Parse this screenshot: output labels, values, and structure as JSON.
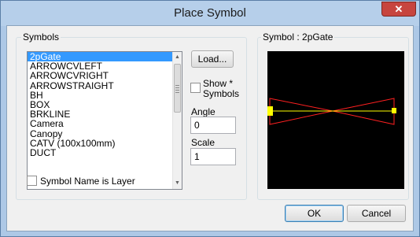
{
  "window": {
    "title": "Place Symbol",
    "close_glyph": "✕"
  },
  "symbols_group": {
    "label": "Symbols",
    "items": [
      {
        "label": "2pGate",
        "selected": true
      },
      {
        "label": "ARROWCVLEFT"
      },
      {
        "label": "ARROWCVRIGHT"
      },
      {
        "label": "ARROWSTRAIGHT"
      },
      {
        "label": "BH"
      },
      {
        "label": "BOX"
      },
      {
        "label": "BRKLINE"
      },
      {
        "label": "Camera"
      },
      {
        "label": "Canopy"
      },
      {
        "label": "CATV (100x100mm)"
      },
      {
        "label": "DUCT"
      }
    ],
    "load_button": "Load...",
    "show_symbols_line1": "Show *",
    "show_symbols_line2": "Symbols",
    "angle_label": "Angle",
    "angle_value": "0",
    "scale_label": "Scale",
    "scale_value": "1",
    "symbol_name_is_layer": "Symbol Name is Layer",
    "show_symbols_checked": false,
    "symbol_name_is_layer_checked": false
  },
  "preview_group": {
    "label": "Symbol : 2pGate",
    "colors": {
      "background": "#000000",
      "outline": "#ff2020",
      "line": "#ffff00"
    }
  },
  "footer": {
    "ok_button": "OK",
    "cancel_button": "Cancel"
  }
}
